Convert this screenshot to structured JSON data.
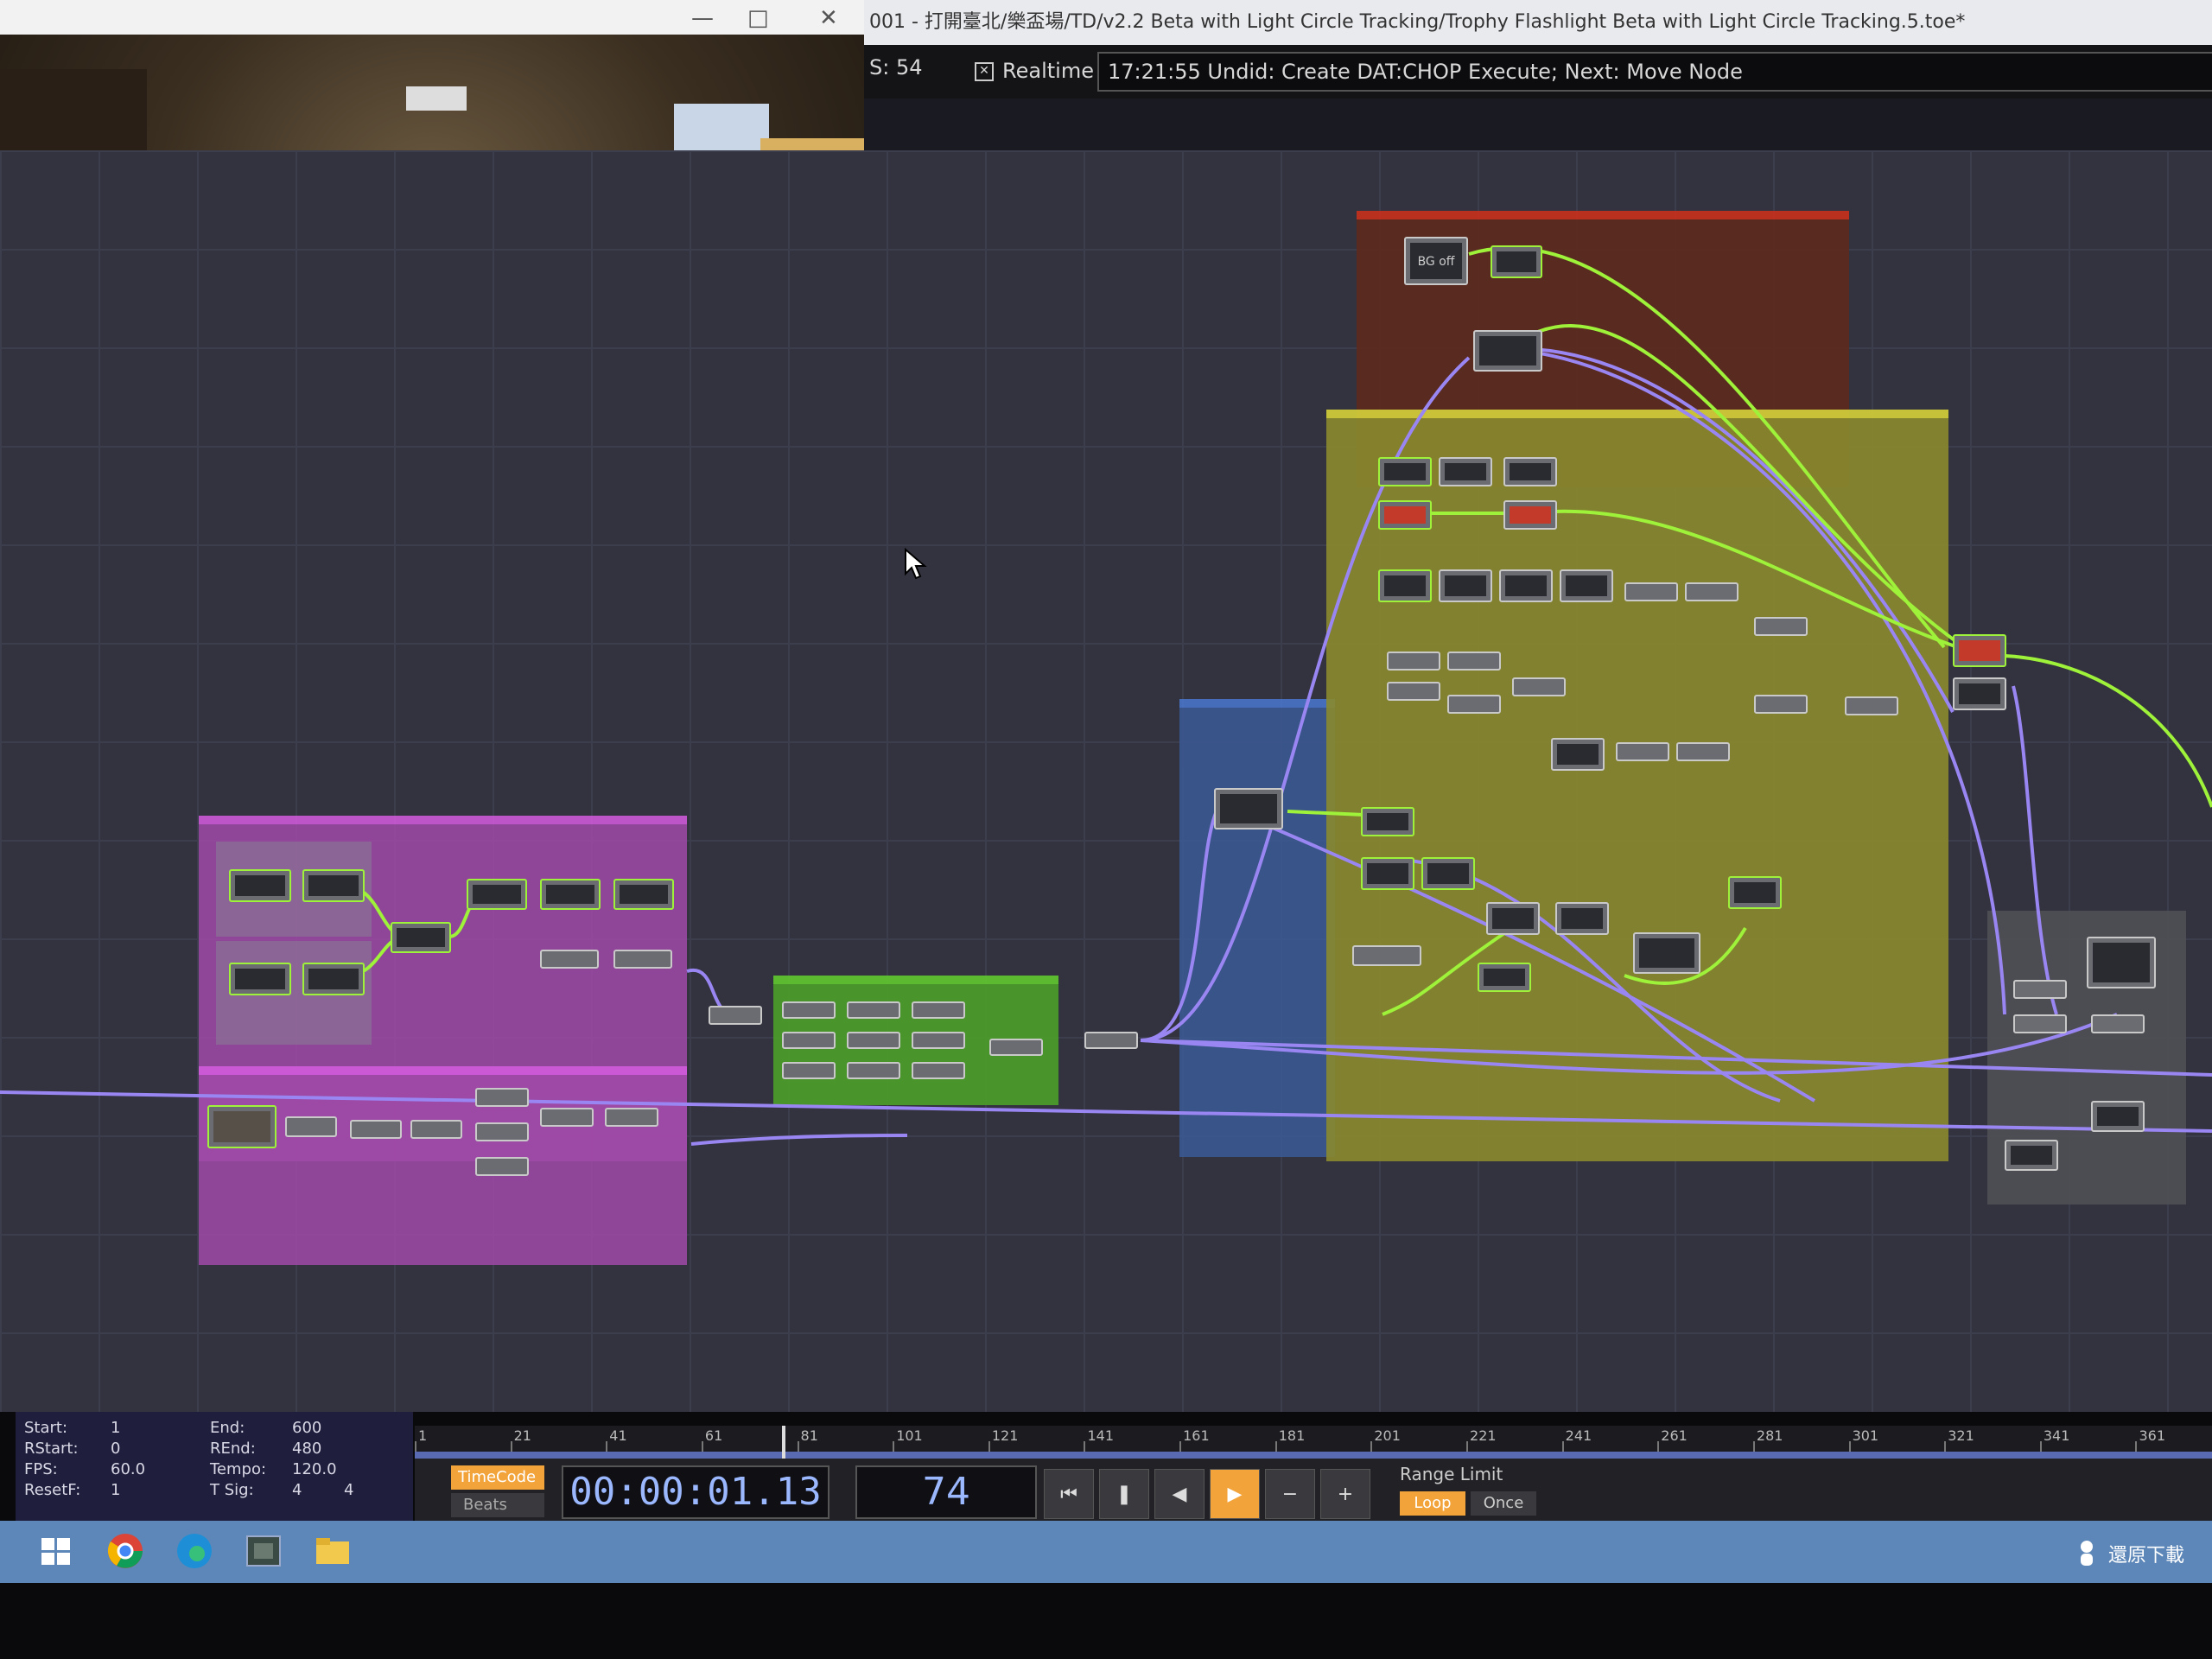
{
  "window": {
    "title": "001 - 打開臺北/樂盃場/TD/v2.2 Beta with Light Circle Tracking/Trophy Flashlight Beta with Light Circle Tracking.5.toe*"
  },
  "status_bar": {
    "fps_label": "S:  54",
    "realtime_label": "Realtime",
    "message": "17:21:55 Undid: Create DAT:CHOP Execute; Next: Move Node"
  },
  "network": {
    "nodes_text": {
      "bg_off": "BG off"
    }
  },
  "range_panel": {
    "start_label": "Start:",
    "start": "1",
    "end_label": "End:",
    "end": "600",
    "rstart_label": "RStart:",
    "rstart": "0",
    "rend_label": "REnd:",
    "rend": "480",
    "fps_label": "FPS:",
    "fps": "60.0",
    "tempo_label": "Tempo:",
    "tempo": "120.0",
    "resetf_label": "ResetF:",
    "resetf": "1",
    "tsig_label": "T Sig:",
    "tsig_a": "4",
    "tsig_b": "4"
  },
  "timeline": {
    "ruler": [
      "1",
      "21",
      "41",
      "61",
      "81",
      "101",
      "121",
      "141",
      "161",
      "181",
      "201",
      "221",
      "241",
      "261",
      "281",
      "301",
      "321",
      "341",
      "361"
    ],
    "mode_timecode": "TimeCode",
    "mode_beats": "Beats",
    "timecode": "00:00:01.13",
    "frame": "74",
    "range_limit_label": "Range Limit",
    "loop": "Loop",
    "once": "Once"
  },
  "taskbar": {
    "tray_text": "還原下載"
  },
  "colors": {
    "accent_orange": "#f2a33a",
    "node_wire_green": "#9ff23a",
    "node_wire_purple": "#9a86f2"
  }
}
